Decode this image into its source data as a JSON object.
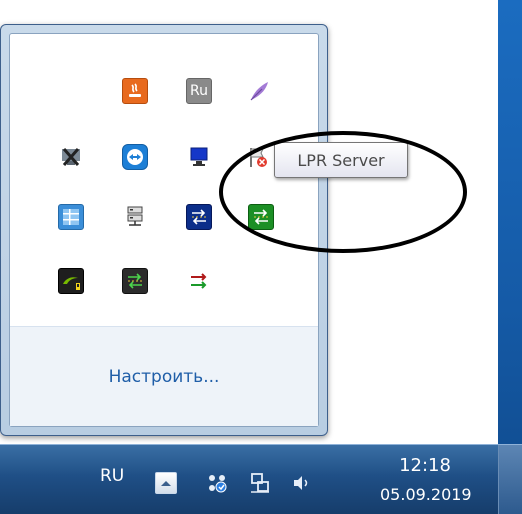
{
  "tray_popup": {
    "customize_label": "Настроить...",
    "icons": [
      {
        "name": "java-icon",
        "label": ""
      },
      {
        "name": "ru-language-icon",
        "label": "Ru"
      },
      {
        "name": "feather-icon",
        "label": ""
      },
      {
        "name": "network-disconnected-icon",
        "label": ""
      },
      {
        "name": "teamviewer-icon",
        "label": ""
      },
      {
        "name": "monitor-icon",
        "label": ""
      },
      {
        "name": "flag-error-icon",
        "label": ""
      },
      {
        "name": "windows-app-icon",
        "label": ""
      },
      {
        "name": "network-server-icon",
        "label": ""
      },
      {
        "name": "blue-transfer-icon",
        "label": ""
      },
      {
        "name": "lpr-server-icon",
        "label": ""
      },
      {
        "name": "nvidia-icon",
        "label": ""
      },
      {
        "name": "green-transfer-icon",
        "label": ""
      },
      {
        "name": "arrows-icon",
        "label": ""
      }
    ]
  },
  "tooltip": {
    "text": "LPR Server"
  },
  "taskbar": {
    "language": "RU",
    "time": "12:18",
    "date": "05.09.2019"
  }
}
